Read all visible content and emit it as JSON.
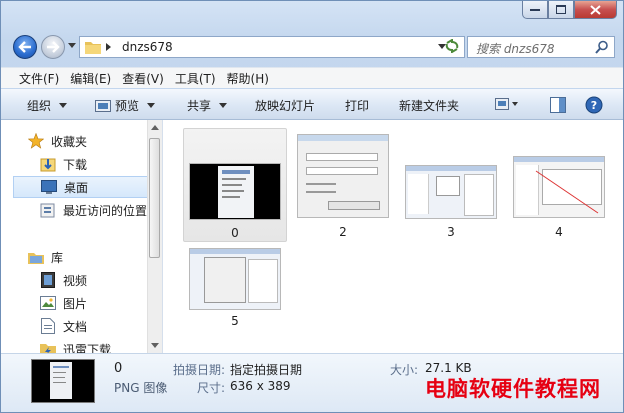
{
  "address": {
    "path": "dnzs678"
  },
  "search": {
    "placeholder": "搜索 dnzs678"
  },
  "menu": [
    "文件(F)",
    "编辑(E)",
    "查看(V)",
    "工具(T)",
    "帮助(H)"
  ],
  "toolbar": {
    "organize": "组织",
    "preview": "预览",
    "share": "共享",
    "slideshow": "幻灯片",
    "slideshow_prefix": "放映",
    "print": "打印",
    "new_folder": "新建文件夹"
  },
  "nav": {
    "favorites": "收藏夹",
    "downloads": "下载",
    "desktop": "桌面",
    "recent": "最近访问的位置",
    "libraries": "库",
    "videos": "视频",
    "pictures": "图片",
    "documents": "文档",
    "thunder": "迅雷下载"
  },
  "files": [
    {
      "label": "0"
    },
    {
      "label": "2"
    },
    {
      "label": "3"
    },
    {
      "label": "4"
    },
    {
      "label": "5"
    }
  ],
  "details": {
    "name": "0",
    "type": "PNG 图像",
    "date_key": "拍摄日期:",
    "date_val": "指定拍摄日期",
    "size_key": "大小:",
    "size_val": "27.1 KB",
    "dim_key": "尺寸:",
    "dim_val": "636 x 389"
  },
  "watermark": "电脑软硬件教程网",
  "colors": {
    "accent": "#3c7fb1",
    "selection": "#d6e8fb",
    "watermark": "#e60012"
  }
}
